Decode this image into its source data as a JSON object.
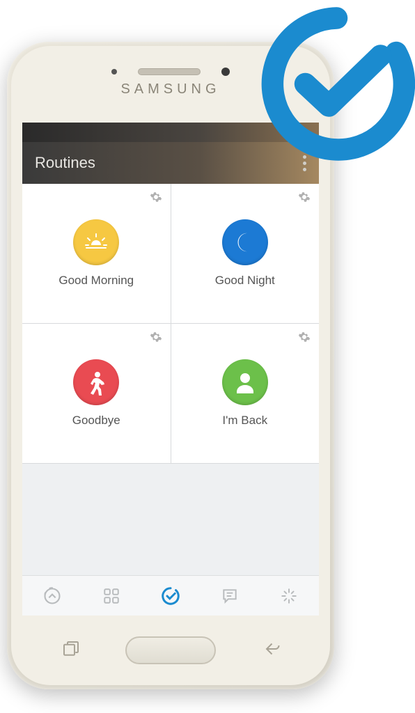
{
  "phone_brand": "SAMSUNG",
  "header": {
    "title": "Routines"
  },
  "routines": [
    {
      "label": "Good Morning",
      "icon": "sunrise",
      "color": "yellow"
    },
    {
      "label": "Good Night",
      "icon": "moon",
      "color": "blue"
    },
    {
      "label": "Goodbye",
      "icon": "walking",
      "color": "red"
    },
    {
      "label": "I'm Back",
      "icon": "person",
      "color": "green"
    }
  ],
  "bottom_nav": {
    "items": [
      "home",
      "grid",
      "check",
      "chat",
      "star"
    ],
    "active_index": 2
  },
  "badge_icon": "check-circle",
  "colors": {
    "accent": "#1b8bcf",
    "yellow": "#f6c842",
    "blue": "#1c7ad4",
    "red": "#e94b52",
    "green": "#6cc04a"
  }
}
